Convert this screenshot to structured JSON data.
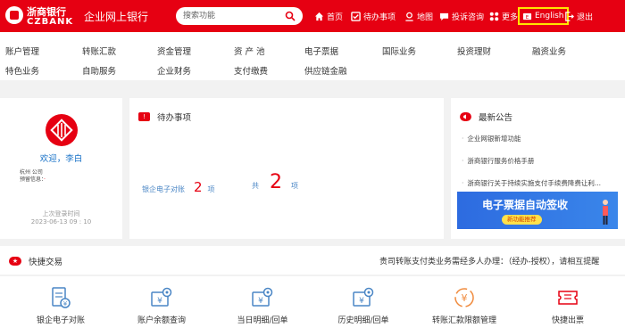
{
  "header": {
    "logo_cn": "浙商银行",
    "logo_en": "CZBANK",
    "system_title": "企业网上银行",
    "search_placeholder": "搜索功能",
    "nav": {
      "home": "首页",
      "todo": "待办事项",
      "map": "地图",
      "complaint": "投诉咨询",
      "more": "更多",
      "english": "English",
      "logout": "退出"
    }
  },
  "menu": {
    "row1": [
      "账户管理",
      "转账汇款",
      "资金管理",
      "资 产 池",
      "电子票据",
      "国际业务",
      "投资理财",
      "融资业务"
    ],
    "row2": [
      "特色业务",
      "自助服务",
      "企业财务",
      "支付缴费",
      "供应链金融"
    ]
  },
  "user": {
    "welcome": "欢迎，李白",
    "company": "杭州                    公司",
    "note_label": "预留信息：",
    "last_login_label": "上次登录时间",
    "last_login_time": "2023-06-13 09 : 10"
  },
  "todo": {
    "title": "待办事项",
    "item_label": "银企电子对账",
    "item_count": "2",
    "item_unit": "项",
    "total_label": "共",
    "total_count": "2",
    "total_unit": "项"
  },
  "notices": {
    "title": "最新公告",
    "items": [
      "企业网银新增功能",
      "浙商银行服务价格手册",
      "浙商银行关于持续实施支付手续费降费让利..."
    ],
    "banner_title": "电子票据自动签收",
    "banner_pill": "新功能推荐"
  },
  "quick": {
    "title": "快捷交易",
    "tip": "贵司转账支付类业务需经多人办理：（经办-授权），请相互提醒",
    "items": [
      "银企电子对账",
      "账户余额查询",
      "当日明细/回单",
      "历史明细/回单",
      "转账汇款限额管理",
      "快捷出票"
    ]
  },
  "colors": {
    "brand_red": "#e60012",
    "link_blue": "#4a86c5",
    "highlight_yellow": "#ffe600"
  }
}
